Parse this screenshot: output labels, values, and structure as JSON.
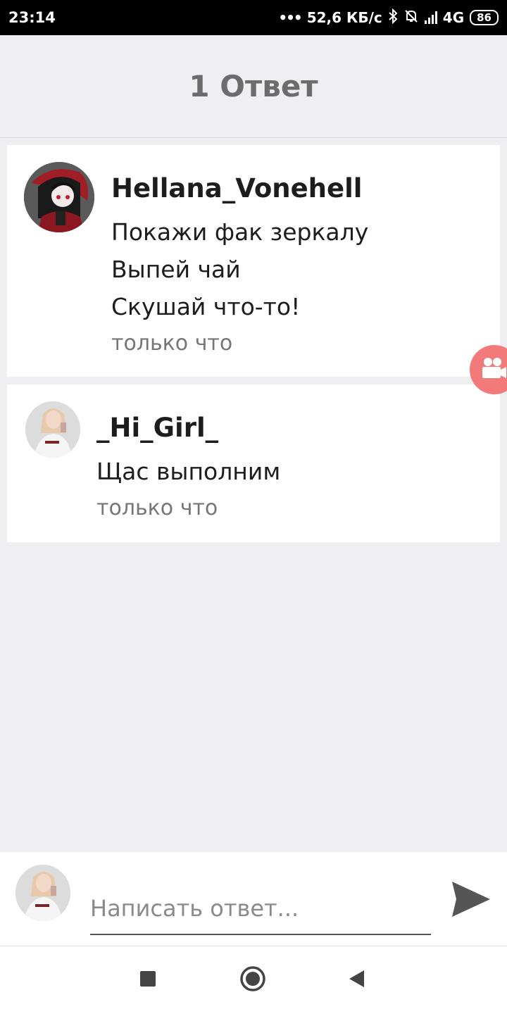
{
  "status_bar": {
    "time": "23:14",
    "speed": "52,6 КБ/с",
    "network": "4G",
    "battery": "86",
    "icons": [
      "bluetooth-icon",
      "mute-bell-icon",
      "signal-icon",
      "battery-icon"
    ]
  },
  "header": {
    "title": "1 Ответ"
  },
  "comments": [
    {
      "username": "Hellana_Vonehell",
      "lines": [
        "Покажи фак зеркалу",
        "Выпей чай",
        "Скушай что-то!"
      ],
      "time": "только что"
    },
    {
      "username": "_Hi_Girl_",
      "lines": [
        "Щас выполним"
      ],
      "time": "только что"
    }
  ],
  "reply": {
    "placeholder": "Написать ответ..."
  },
  "colors": {
    "accent": "#f27a7a",
    "background": "#efeef1",
    "card": "#ffffff",
    "muted": "#767676"
  }
}
